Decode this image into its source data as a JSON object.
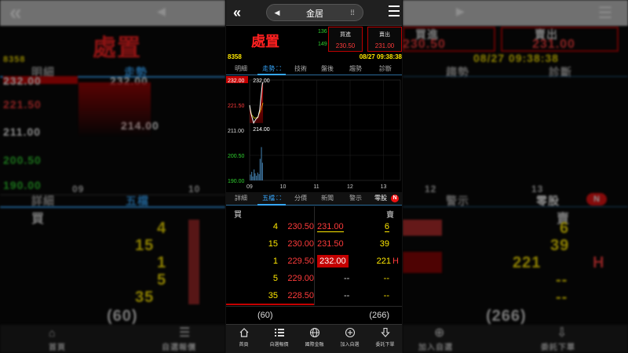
{
  "nav": {
    "stock_name": "金居"
  },
  "header": {
    "title": "處置",
    "buy_volume": "136",
    "sell_volume": "149",
    "buy_label": "買進",
    "buy_price": "230.50",
    "sell_label": "賣出",
    "sell_price": "231.00"
  },
  "info": {
    "code": "8358",
    "datetime": "08/27 09:38:38"
  },
  "top_tabs": [
    "明細",
    "走勢",
    "技術",
    "盤後",
    "趨勢",
    "診斷"
  ],
  "top_tab_active": 1,
  "lower_tabs": [
    "詳細",
    "五檔",
    "分價",
    "新聞",
    "警示",
    "零股"
  ],
  "lower_tab_active": 1,
  "lower_tab_badge": "N",
  "chart_data": {
    "type": "line",
    "y_ticks": [
      "232.00",
      "221.50",
      "211.00",
      "200.50",
      "190.00"
    ],
    "x_ticks": [
      "09",
      "10",
      "11",
      "12",
      "13"
    ],
    "ylim": [
      190.0,
      232.0
    ],
    "high_label": "232.00",
    "low_label": "214.00",
    "price_series": [
      {
        "t": 9.0,
        "p": 221.5
      },
      {
        "t": 9.04,
        "p": 218.0
      },
      {
        "t": 9.08,
        "p": 216.0
      },
      {
        "t": 9.12,
        "p": 214.0
      },
      {
        "t": 9.18,
        "p": 215.5
      },
      {
        "t": 9.25,
        "p": 216.5
      },
      {
        "t": 9.3,
        "p": 219.5
      },
      {
        "t": 9.34,
        "p": 225.0
      },
      {
        "t": 9.38,
        "p": 230.5
      },
      {
        "t": 9.4,
        "p": 231.0
      }
    ],
    "avg_series": [
      {
        "t": 9.0,
        "p": 221.0
      },
      {
        "t": 9.06,
        "p": 217.5
      },
      {
        "t": 9.14,
        "p": 216.0
      },
      {
        "t": 9.24,
        "p": 216.5
      },
      {
        "t": 9.32,
        "p": 219.0
      },
      {
        "t": 9.4,
        "p": 222.5
      }
    ],
    "volume_t": [
      9.02,
      9.06,
      9.09,
      9.13,
      9.16,
      9.2,
      9.24,
      9.28,
      9.31,
      9.35,
      9.38
    ],
    "volume_v": [
      0.15,
      0.22,
      0.1,
      0.28,
      0.18,
      0.12,
      0.2,
      0.16,
      0.55,
      0.85,
      0.45
    ],
    "colors": {
      "price": "#ffffff",
      "avg": "#ffe800",
      "fill": "#c40000",
      "volume": "#3a6e96"
    }
  },
  "orderbook": {
    "buy_header": "買",
    "sell_header": "賣",
    "rows": [
      {
        "buy_qty": "4",
        "buy_price": "230.50",
        "sell_price": "231.00",
        "sell_qty": "6",
        "flag": ""
      },
      {
        "buy_qty": "15",
        "buy_price": "230.00",
        "sell_price": "231.50",
        "sell_qty": "39",
        "flag": ""
      },
      {
        "buy_qty": "1",
        "buy_price": "229.50",
        "sell_price": "232.00",
        "sell_qty": "221",
        "flag": "H"
      },
      {
        "buy_qty": "5",
        "buy_price": "229.00",
        "sell_price": "--",
        "sell_qty": "--",
        "flag": ""
      },
      {
        "buy_qty": "35",
        "buy_price": "228.50",
        "sell_price": "--",
        "sell_qty": "--",
        "flag": ""
      }
    ],
    "buy_total": "(60)",
    "sell_total": "(266)"
  },
  "bottom_nav": [
    {
      "label": "首頁",
      "icon": "home-icon"
    },
    {
      "label": "自選報價",
      "icon": "list-icon"
    },
    {
      "label": "國際金融",
      "icon": "globe-icon"
    },
    {
      "label": "加入自選",
      "icon": "plus-circle-icon"
    },
    {
      "label": "委託下單",
      "icon": "download-icon"
    }
  ],
  "side_left": {
    "title": "處置",
    "code": "8358",
    "tab_a": "明細",
    "tab_b": "走勢",
    "tab_c": "詳細",
    "tab_d": "五檔",
    "y_ticks": [
      "232.00",
      "221.50",
      "211.00",
      "200.50",
      "190.00"
    ],
    "x_ticks": [
      "09",
      "10"
    ],
    "low": "214.00",
    "buy_header": "買",
    "qtys": [
      "4",
      "15",
      "1",
      "5",
      "35"
    ],
    "total": "(60)",
    "nav_a": "首頁",
    "nav_b": "自選報價"
  },
  "side_right": {
    "buy_label": "買進",
    "sell_label": "賣出",
    "buy_price": "230.50",
    "sell_price": "231.00",
    "time": "08/27 09:38:38",
    "tab_a": "趨勢",
    "tab_b": "診斷",
    "x_ticks": [
      "12",
      "13"
    ],
    "tab_c": "警示",
    "tab_d": "零股",
    "badge": "N",
    "sell_header": "賣",
    "qtys": [
      "6",
      "39",
      "221",
      "--",
      "--"
    ],
    "flag": "H",
    "total": "(266)",
    "nav_a": "加入自選",
    "nav_b": "委託下單"
  }
}
